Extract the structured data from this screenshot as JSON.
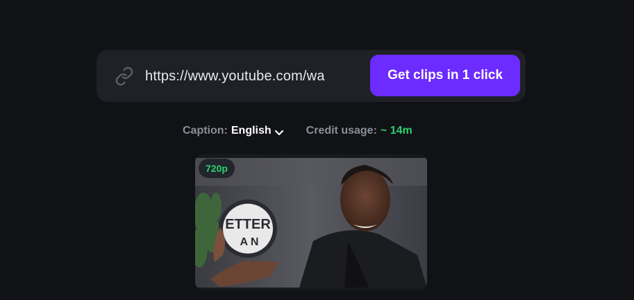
{
  "url_bar": {
    "value": "https://www.youtube.com/wa",
    "button_label": "Get clips in 1 click"
  },
  "options": {
    "caption_label": "Caption:",
    "caption_value": "English",
    "credit_label": "Credit usage:",
    "credit_value": "~ 14m"
  },
  "video": {
    "resolution_badge": "720p"
  },
  "colors": {
    "background": "#111216",
    "bar": "#1f2127",
    "accent": "#6c2bff",
    "success": "#2bd16f"
  },
  "icons": [
    "link-icon",
    "chevron-down-icon"
  ]
}
